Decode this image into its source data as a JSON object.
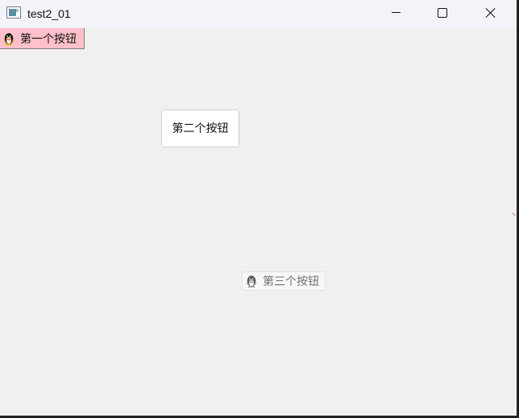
{
  "window": {
    "title": "test2_01"
  },
  "controls": {
    "minimize_icon": "minimize-icon",
    "maximize_icon": "maximize-icon",
    "close_icon": "close-icon"
  },
  "buttons": [
    {
      "label": "第一个按钮",
      "icon": "qq-penguin-icon",
      "background": "#ffc0cb",
      "state": "normal"
    },
    {
      "label": "第二个按钮",
      "icon": "",
      "background": "#ffffff",
      "state": "normal"
    },
    {
      "label": "第三个按钮",
      "icon": "qq-penguin-icon",
      "background": "#f7f7f7",
      "state": "disabled"
    }
  ],
  "colors": {
    "window_background": "#f0f0f0",
    "titlebar_background": "#f3f3f9",
    "accent_pink": "#ffc0cb"
  }
}
